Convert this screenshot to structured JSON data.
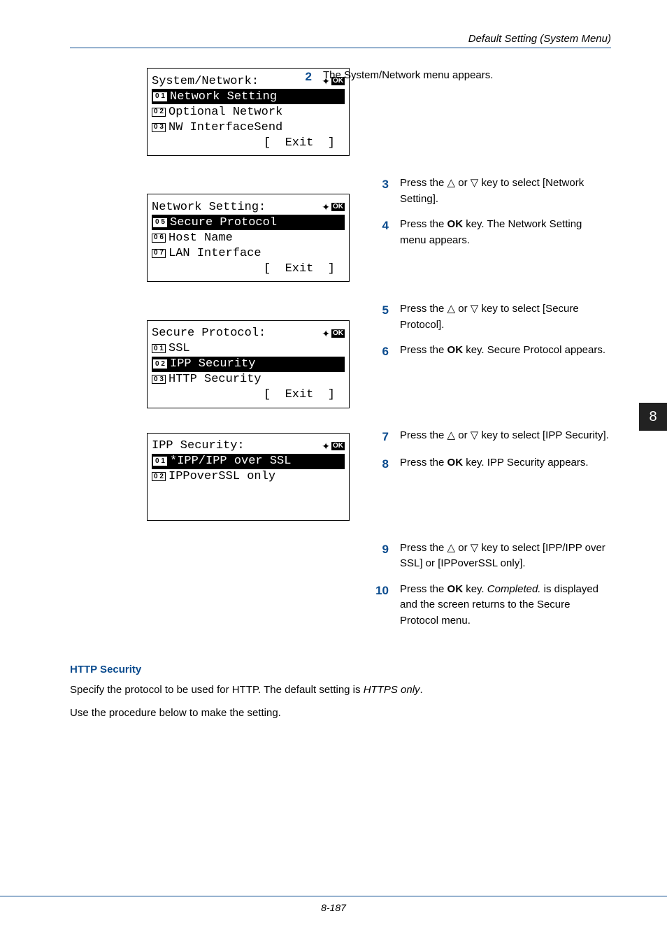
{
  "header": {
    "title": "Default Setting (System Menu)"
  },
  "side_tab": "8",
  "lcd1": {
    "title": "System/Network:",
    "nav_glyph": "✦",
    "ok": "OK",
    "items": [
      {
        "badge": "0 1",
        "label": "Network Setting",
        "hl": true
      },
      {
        "badge": "0 2",
        "label": "Optional Network",
        "hl": false
      },
      {
        "badge": "0 3",
        "label": "NW InterfaceSend",
        "hl": false
      }
    ],
    "footer": "[  Exit  ]"
  },
  "steps_a": [
    {
      "n": "2",
      "t": "The System/Network menu appears."
    }
  ],
  "steps_b": [
    {
      "n": "3",
      "pre": "Press the ",
      "tri_up": "△",
      "mid": " or ",
      "tri_dn": "▽",
      "post": " key to select [Network Setting]."
    },
    {
      "n": "4",
      "pre": "Press the ",
      "bold": "OK",
      "post": " key. The Network Setting menu appears."
    }
  ],
  "lcd2": {
    "title": "Network Setting:",
    "nav_glyph": "✦",
    "ok": "OK",
    "items": [
      {
        "badge": "0 5",
        "label": "Secure Protocol",
        "hl": true
      },
      {
        "badge": "0 6",
        "label": "Host Name",
        "hl": false
      },
      {
        "badge": "0 7",
        "label": "LAN Interface",
        "hl": false
      }
    ],
    "footer": "[  Exit  ]"
  },
  "steps_c": [
    {
      "n": "5",
      "pre": "Press the ",
      "tri_up": "△",
      "mid": " or ",
      "tri_dn": "▽",
      "post": " key to select [Secure Protocol]."
    },
    {
      "n": "6",
      "pre": "Press the ",
      "bold": "OK",
      "post": " key. Secure Protocol appears."
    }
  ],
  "lcd3": {
    "title": "Secure Protocol:",
    "nav_glyph": "✦",
    "ok": "OK",
    "items": [
      {
        "badge": "0 1",
        "label": "SSL",
        "hl": false
      },
      {
        "badge": "0 2",
        "label": "IPP Security",
        "hl": true
      },
      {
        "badge": "0 3",
        "label": "HTTP Security",
        "hl": false
      }
    ],
    "footer": "[  Exit  ]"
  },
  "steps_d": [
    {
      "n": "7",
      "pre": "Press the ",
      "tri_up": "△",
      "mid": " or ",
      "tri_dn": "▽",
      "post": " key to select [IPP Security]."
    },
    {
      "n": "8",
      "pre": "Press the ",
      "bold": "OK",
      "post": " key. IPP Security appears."
    }
  ],
  "lcd4": {
    "title": "IPP Security:",
    "nav_glyph": "✦",
    "ok": "OK",
    "items": [
      {
        "badge": "0 1",
        "label": "*IPP/IPP over SSL",
        "hl": true
      },
      {
        "badge": "0 2",
        "label": "IPPoverSSL only",
        "hl": false
      }
    ],
    "footer": ""
  },
  "steps_e": [
    {
      "n": "9",
      "pre": "Press the ",
      "tri_up": "△",
      "mid": " or ",
      "tri_dn": "▽",
      "post": " key to select [IPP/IPP over SSL] or [IPPoverSSL only]."
    },
    {
      "n": "10",
      "pre": "Press the ",
      "bold": "OK",
      "post_pre": " key. ",
      "ital": "Completed.",
      "post": " is displayed and the screen returns to the Secure Protocol menu."
    }
  ],
  "section": {
    "head": "HTTP Security",
    "p1_pre": "Specify the protocol to be used for HTTP. The default setting is ",
    "p1_ital": "HTTPS only",
    "p1_post": ".",
    "p2": "Use the procedure below to make the setting."
  },
  "footer": {
    "page": "8-187"
  }
}
